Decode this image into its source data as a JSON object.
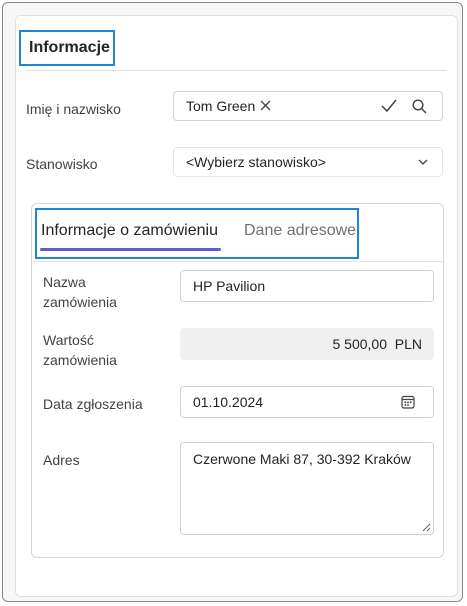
{
  "section": {
    "title": "Informacje"
  },
  "person": {
    "label": "Imię i nazwisko",
    "value": "Tom Green",
    "icons": {
      "clear": "close-icon",
      "confirm": "checkmark-icon",
      "search": "search-icon"
    }
  },
  "position": {
    "label": "Stanowisko",
    "value": "<Wybierz stanowisko>",
    "icon": "chevron-down-icon"
  },
  "tabs": [
    {
      "label": "Informacje o zamówieniu",
      "active": true
    },
    {
      "label": "Dane adresowe",
      "active": false
    }
  ],
  "order": {
    "name_label": "Nazwa zamówienia",
    "name_value": "HP Pavilion",
    "value_label": "Wartość zamówienia",
    "value_value": "5 500,00  PLN",
    "date_label": "Data zgłoszenia",
    "date_value": "01.10.2024",
    "date_icon": "calendar-icon",
    "address_label": "Adres",
    "address_value": "Czerwone Maki 87, 30-392 Kraków"
  },
  "colors": {
    "accent": "#5b5fc7",
    "highlight": "#1f85d8"
  }
}
